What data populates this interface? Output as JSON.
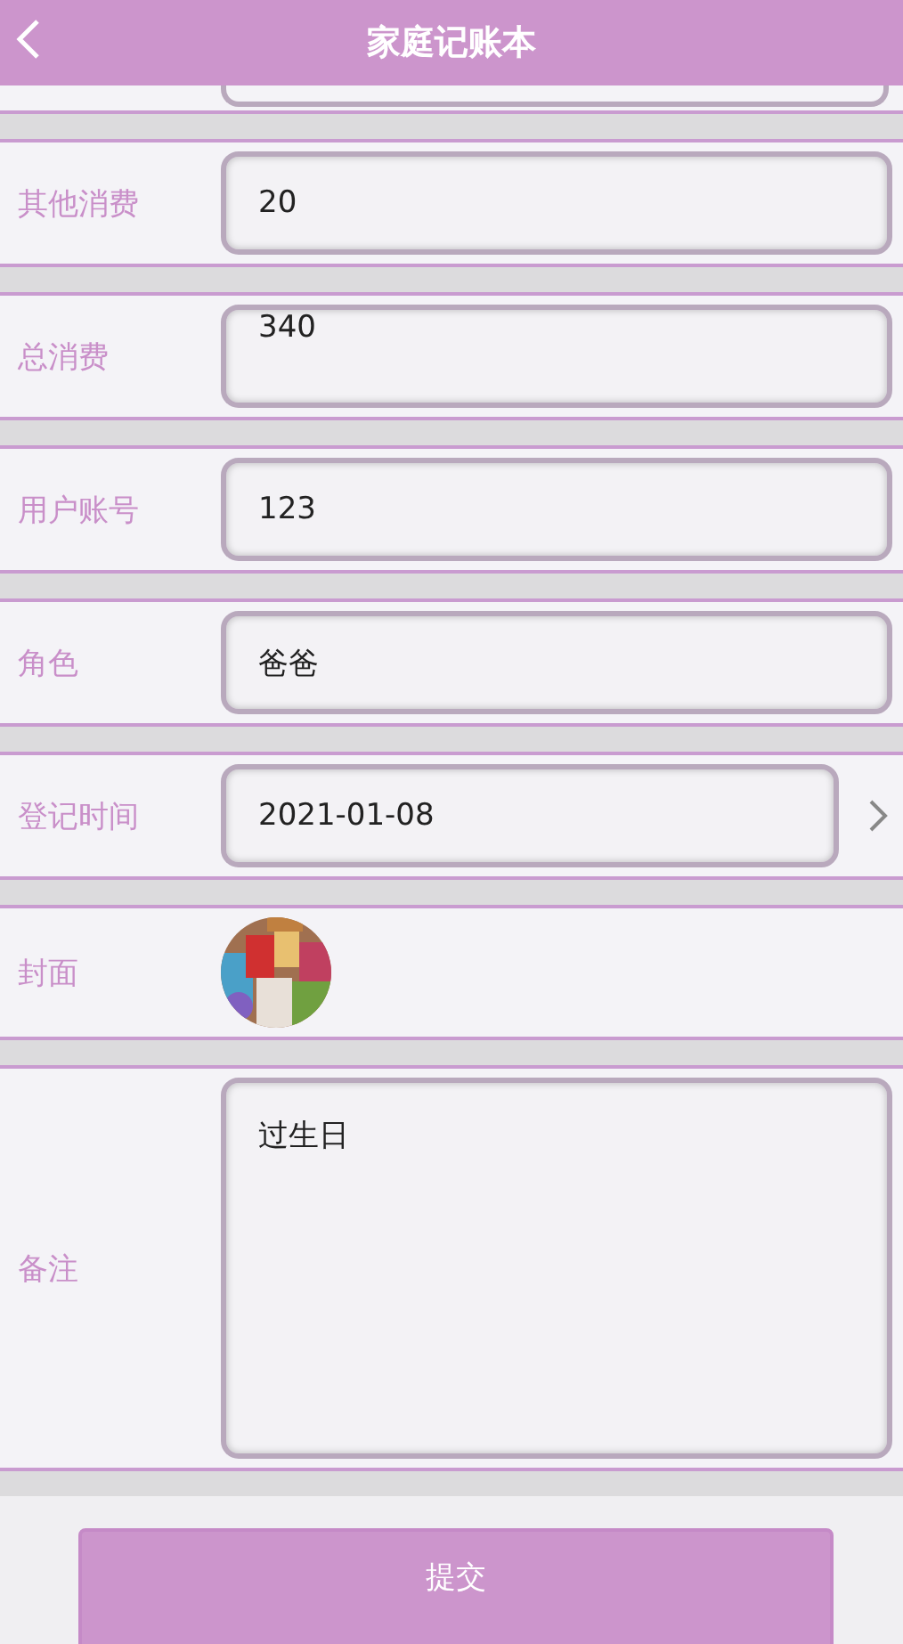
{
  "header": {
    "title": "家庭记账本"
  },
  "fields": [
    {
      "kind": "text",
      "label": "其他消费",
      "value": "20"
    },
    {
      "kind": "text_top",
      "label": "总消费",
      "value": "340"
    },
    {
      "kind": "text",
      "label": "用户账号",
      "value": "123"
    },
    {
      "kind": "text",
      "label": "角色",
      "value": "爸爸"
    },
    {
      "kind": "date",
      "label": "登记时间",
      "value": "2021-01-08"
    },
    {
      "label": "封面"
    },
    {
      "kind": "textarea",
      "label": "备注",
      "value": "过生日"
    }
  ],
  "submit": {
    "label": "提交"
  }
}
